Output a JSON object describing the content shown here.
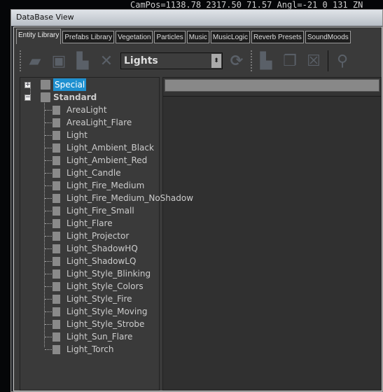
{
  "overlay": {
    "campos": "CamPos=1138.78 2317.50 71.57 Angl=-21  0 131 ZN"
  },
  "window": {
    "title": "DataBase View"
  },
  "tabs": [
    "Entity Library",
    "Prefabs Library",
    "Vegetation",
    "Particles",
    "Music",
    "MusicLogic",
    "Reverb Presets",
    "SoundMoods"
  ],
  "active_tab": "Entity Library",
  "toolbar": {
    "library_select": "Lights",
    "icons": [
      "open-folder-icon",
      "save-icon",
      "add-document-icon",
      "delete-icon",
      "refresh-icon",
      "new-item-icon",
      "clone-item-icon",
      "remove-item-icon",
      "assign-object-icon"
    ]
  },
  "tree": {
    "groups": [
      {
        "label": "Special",
        "expanded": false,
        "selected": true
      },
      {
        "label": "Standard",
        "expanded": true,
        "selected": false
      }
    ],
    "items": [
      "AreaLight",
      "AreaLight_Flare",
      "Light",
      "Light_Ambient_Black",
      "Light_Ambient_Red",
      "Light_Candle",
      "Light_Fire_Medium",
      "Light_Fire_Medium_NoShadow",
      "Light_Fire_Small",
      "Light_Flare",
      "Light_Projector",
      "Light_ShadowHQ",
      "Light_ShadowLQ",
      "Light_Style_Blinking",
      "Light_Style_Colors",
      "Light_Style_Fire",
      "Light_Style_Moving",
      "Light_Style_Strobe",
      "Light_Sun_Flare",
      "Light_Torch"
    ]
  }
}
